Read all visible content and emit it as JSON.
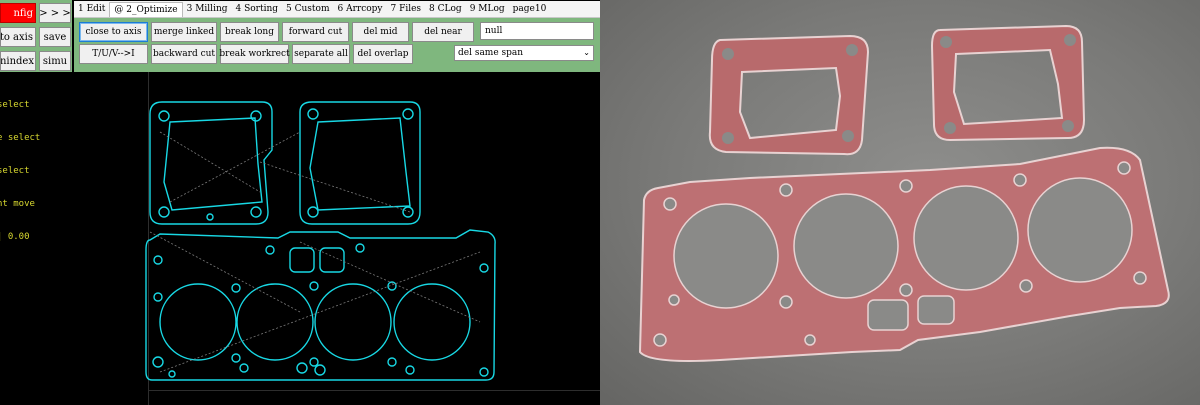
{
  "side_tools": {
    "config_label": "nfig",
    "collapse_label": "> > >",
    "to_axis_label": "to axis",
    "save_label": "save",
    "runindex_label": "runindex",
    "simu_label": "simu"
  },
  "tabs": [
    {
      "label": "1 Edit"
    },
    {
      "label": "@ 2_Optimize",
      "active": true
    },
    {
      "label": "3 Milling"
    },
    {
      "label": "4 Sorting"
    },
    {
      "label": "5 Custom"
    },
    {
      "label": "6 Arrcopy"
    },
    {
      "label": "7 Files"
    },
    {
      "label": "8 CLog"
    },
    {
      "label": "9 MLog"
    },
    {
      "label": "page10"
    }
  ],
  "optimize": {
    "row1": [
      "close to axis",
      "merge linked",
      "break long",
      "forward cut",
      "del mid",
      "del near"
    ],
    "row2": [
      "T/U/V-->I",
      "backward cut",
      "break workrect",
      "separate all",
      "del overlap"
    ],
    "input_value": "null",
    "select_value": "del same span"
  },
  "console": {
    "lines": [
      "select",
      "e select",
      "select",
      "nt move",
      "| 0.00"
    ]
  },
  "colors": {
    "panel_green": "#7fb77e",
    "cad_cyan": "#18d8e4",
    "console_yellow": "#d8d830",
    "gasket_red": "#b86a6c"
  }
}
